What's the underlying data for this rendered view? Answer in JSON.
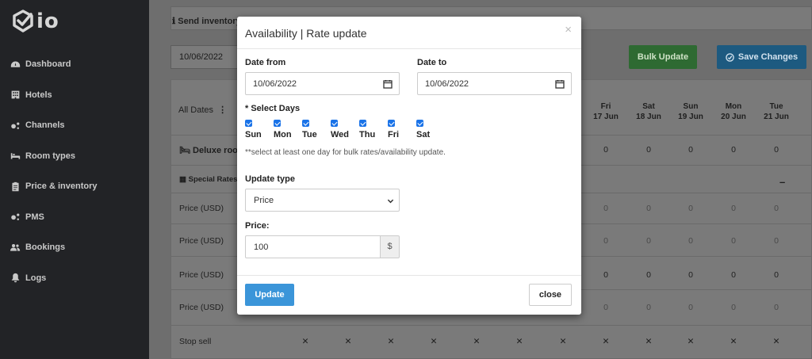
{
  "brand": {
    "logo_text": "io"
  },
  "sidebar": {
    "items": [
      {
        "label": "Dashboard",
        "icon": "dashboard-icon"
      },
      {
        "label": "Hotels",
        "icon": "hotel-icon"
      },
      {
        "label": "Channels",
        "icon": "channels-icon"
      },
      {
        "label": "Room types",
        "icon": "bed-icon"
      },
      {
        "label": "Price & inventory",
        "icon": "clipboard-icon"
      },
      {
        "label": "PMS",
        "icon": "pms-icon"
      },
      {
        "label": "Bookings",
        "icon": "users-icon"
      },
      {
        "label": "Logs",
        "icon": "bell-icon"
      }
    ]
  },
  "main": {
    "send_inventory_label": "Send inventory",
    "date_value": "10/06/2022",
    "bulk_update_label": "Bulk Update",
    "save_changes_label": "Save Changes",
    "all_dates_label": "All Dates",
    "days": [
      {
        "dow": "Fri",
        "date": "17 Jun"
      },
      {
        "dow": "Sat",
        "date": "18 Jun"
      },
      {
        "dow": "Sun",
        "date": "19 Jun"
      },
      {
        "dow": "Mon",
        "date": "20 Jun"
      },
      {
        "dow": "Tue",
        "date": "21 Jun"
      }
    ],
    "rows": {
      "room_label": "Deluxe room",
      "special_rates_label": "Special Rates",
      "price_label": "Price (USD)",
      "stop_sell_label": "Stop sell",
      "cell_value": "0",
      "stop_mark": "✕",
      "collapse_mark": "–"
    }
  },
  "modal": {
    "title": "Availability | Rate update",
    "close_icon_char": "×",
    "date_from_label": "Date from",
    "date_from_value": "10/06/2022",
    "date_to_label": "Date to",
    "date_to_value": "10/06/2022",
    "select_days_label": "* Select Days",
    "days": [
      "Sun",
      "Mon",
      "Tue",
      "Wed",
      "Thu",
      "Fri",
      "Sat"
    ],
    "note": "**select at least one day for bulk rates/availability update.",
    "update_type_label": "Update type",
    "update_type_value": "Price",
    "price_label": "Price:",
    "price_value": "100",
    "currency_addon": "$",
    "update_button": "Update",
    "close_button": "close"
  }
}
